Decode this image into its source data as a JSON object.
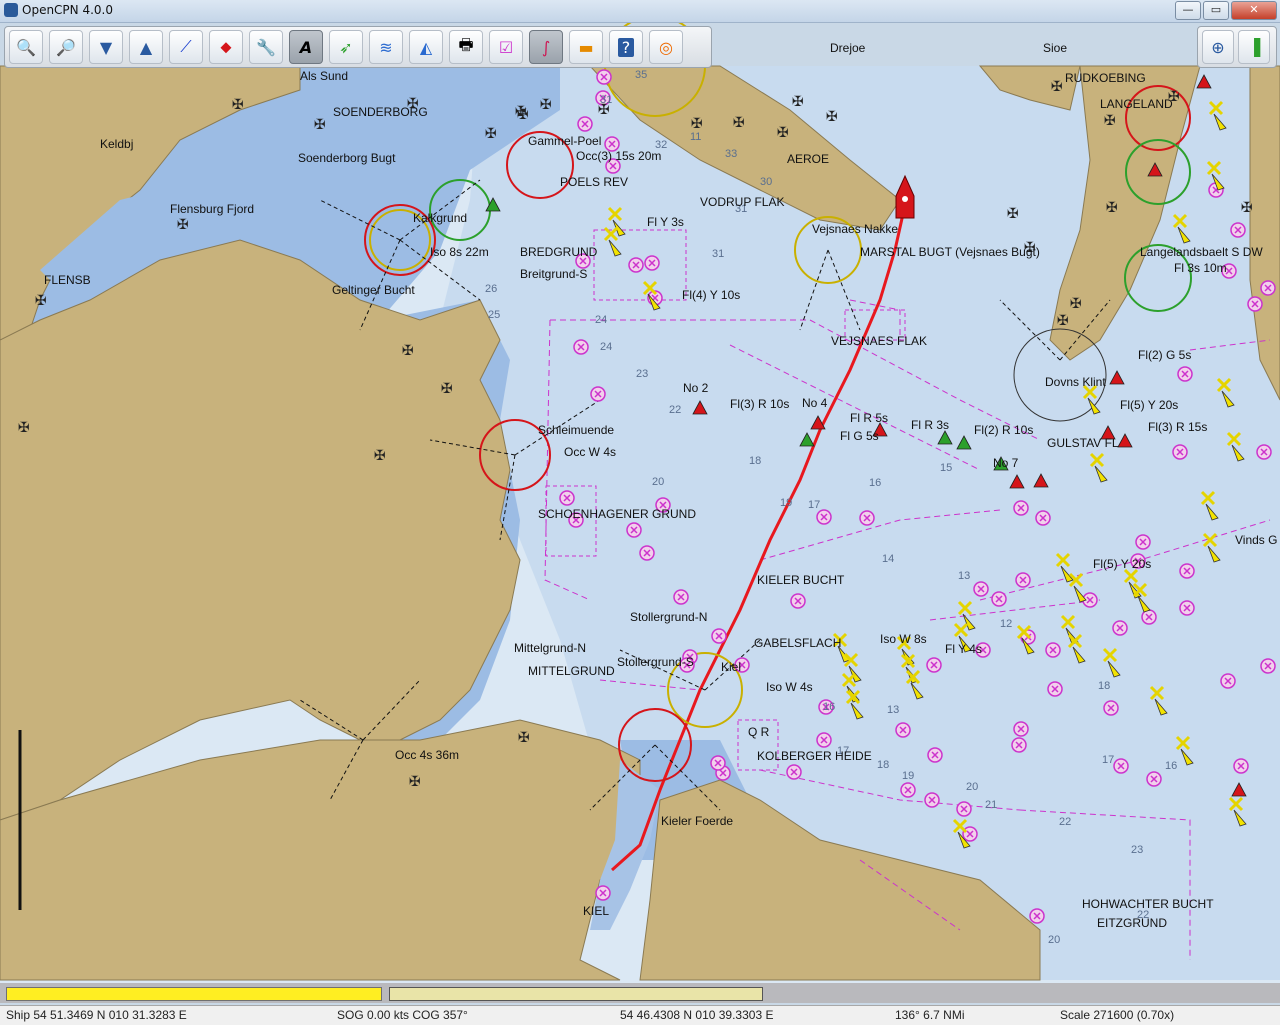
{
  "window": {
    "title": "OpenCPN 4.0.0",
    "controls": {
      "minimize": "—",
      "maximize": "▭",
      "close": "✕"
    }
  },
  "toolbar": {
    "tools": [
      {
        "name": "zoom-in",
        "icon": "zoom-in-icon"
      },
      {
        "name": "zoom-out",
        "icon": "zoom-out-icon"
      },
      {
        "name": "scale-in",
        "icon": "scale-in-icon"
      },
      {
        "name": "scale-out",
        "icon": "scale-out-icon"
      },
      {
        "name": "route",
        "icon": "route-icon"
      },
      {
        "name": "auto-follow",
        "icon": "ship-icon"
      },
      {
        "name": "settings",
        "icon": "wrench-icon"
      },
      {
        "name": "text",
        "icon": "text-icon"
      },
      {
        "name": "current",
        "icon": "current-icon"
      },
      {
        "name": "tide",
        "icon": "tide-icon"
      },
      {
        "name": "print",
        "icon": "print-icon"
      },
      {
        "name": "route-manager",
        "icon": "route-manager-icon"
      },
      {
        "name": "track",
        "icon": "track-icon"
      },
      {
        "name": "color-scheme",
        "icon": "color-scheme-icon"
      },
      {
        "name": "help",
        "icon": "help-icon"
      },
      {
        "name": "mob",
        "icon": "lifebuoy-icon"
      }
    ]
  },
  "chart": {
    "colors": {
      "land": "#c8b27c",
      "shallow": "#8fb4e3",
      "medium": "#b9d2ee",
      "deep": "#dce9f5",
      "track": "#e8181e",
      "magenta": "#cc33cc"
    },
    "labels": [
      "Drejoe",
      "Sioe",
      "Als Sund",
      "RUDKOEBING",
      "LANGELAND",
      "SOENDERBORG",
      "Keldbj",
      "Gammel-Poel",
      "Soenderborg Bugt",
      "Occ(3) 15s 20m",
      "Kalkgrund",
      "POELS REV",
      "AEROE",
      "VODRUP FLAK",
      "Flensburg Fjord",
      "Vejsnaes Nakke",
      "MARSTAL BUGT (Vejsnaes Bugt)",
      "Iso 8s 22m",
      "BREDGRUND",
      "Breitgrund-S",
      "Fl Y 3s",
      "Geltinger Bucht",
      "FLENSB",
      "Fl(4) Y 10s",
      "VEJSNAES FLAK",
      "Dovns Klint",
      "Fl(2) G 5s",
      "No 2",
      "Fl(3) R 10s",
      "No 4",
      "Fl R 5s",
      "Fl G 5s",
      "Fl R 3s",
      "Fl(2) R 10s",
      "Fl(5) Y 20s",
      "Fl(3) R 15s",
      "GULSTAV FL",
      "No 7",
      "Schleimuende",
      "Occ W 4s",
      "SCHOENHAGENER GRUND",
      "KIELER BUCHT",
      "Stollergrund-N",
      "Mittelgrund-N",
      "MITTELGRUND",
      "Stollergrund-S",
      "GABELSFLACH",
      "Iso W 4s",
      "Iso W 8s",
      "Kiel",
      "Q R",
      "KOLBERGER HEIDE",
      "Fl Y 4s",
      "Occ 4s 36m",
      "Kieler Foerde",
      "KIEL",
      "HOHWACHTER BUCHT",
      "EITZGRUND",
      "Fl(5) Y 20s",
      "Vinds G",
      "Langelandsbaelt S DW",
      "Fl 3s 10m"
    ],
    "depths": [
      "35",
      "31",
      "32",
      "11",
      "33",
      "30",
      "31",
      "31",
      "24",
      "24",
      "26",
      "25",
      "23",
      "22",
      "20",
      "19",
      "18",
      "17",
      "16",
      "15",
      "14",
      "13",
      "12",
      "13",
      "16",
      "17",
      "18",
      "19",
      "20",
      "21",
      "22",
      "23",
      "22",
      "20",
      "18",
      "16",
      "17"
    ]
  },
  "scrollbars": {
    "left_fill": 1.0,
    "right_fill": 1.0
  },
  "status": {
    "ship": "Ship 54 51.3469 N   010 31.3283 E",
    "sog_cog": "SOG 0.00 kts  COG 357°",
    "cursor": "54 46.4308 N   010 39.3303 E",
    "bearing": "136°  6.7 NMi",
    "scale": "Scale 271600 (0.70x)"
  }
}
